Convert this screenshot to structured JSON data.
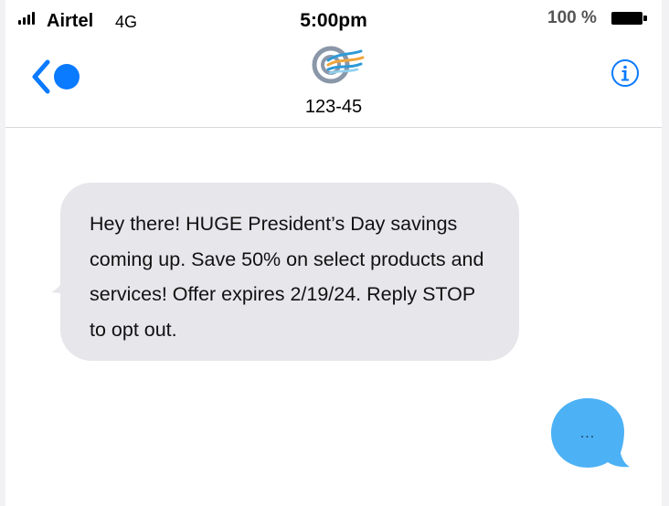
{
  "status_bar": {
    "carrier": "Airtel",
    "network": "4G",
    "time": "5:00pm",
    "battery_percent": "100 %"
  },
  "header": {
    "contact_name": "123-45",
    "icons": {
      "back": "back-chevron-icon",
      "info": "info-icon",
      "avatar": "brand-logo-avatar"
    }
  },
  "messages": [
    {
      "direction": "incoming",
      "text": "Hey there! HUGE President’s Day savings coming up. Save 50% on select products and services! Offer expires 2/19/24. Reply STOP to opt out."
    }
  ],
  "typing_indicator": {
    "text": "..."
  },
  "colors": {
    "accent": "#0a7aff",
    "incoming_bubble": "#e6e6eb",
    "typing_bubble": "#4db1f5"
  }
}
